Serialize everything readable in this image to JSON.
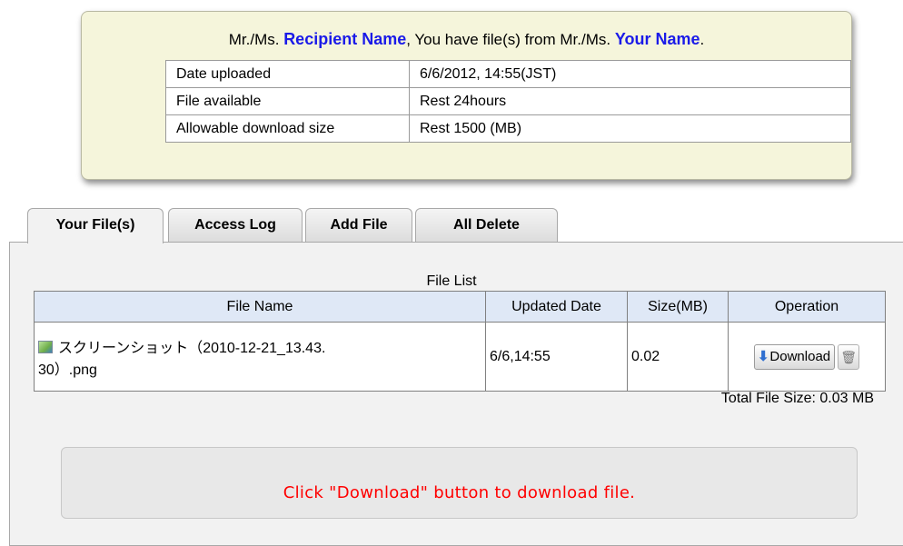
{
  "greeting": {
    "prefix1": "Mr./Ms. ",
    "recipient": "Recipient Name",
    "middle": ", You have file(s) from Mr./Ms. ",
    "sender": "Your Name",
    "suffix": "."
  },
  "info": [
    {
      "label": "Date uploaded",
      "value": "6/6/2012, 14:55(JST)"
    },
    {
      "label": "File available",
      "value": "Rest 24hours"
    },
    {
      "label": "Allowable download size",
      "value": "Rest 1500 (MB)"
    }
  ],
  "tabs": [
    "Your File(s)",
    "Access Log",
    "Add File",
    "All Delete"
  ],
  "file_list": {
    "title": "File List",
    "columns": [
      "File Name",
      "Updated Date",
      "Size(MB)",
      "Operation"
    ],
    "rows": [
      {
        "name_line1": "スクリーンショット（2010-12-21_13.43.",
        "name_line2": "30）.png",
        "date": "6/6,14:55",
        "size": "0.02",
        "download_label": "Download"
      }
    ],
    "total": "Total File Size: 0.03 MB"
  },
  "notice": "Click \"Download\" button to download file.",
  "icons": {
    "file": "image-file-icon",
    "download": "down-arrow-icon",
    "delete": "trash-icon"
  }
}
